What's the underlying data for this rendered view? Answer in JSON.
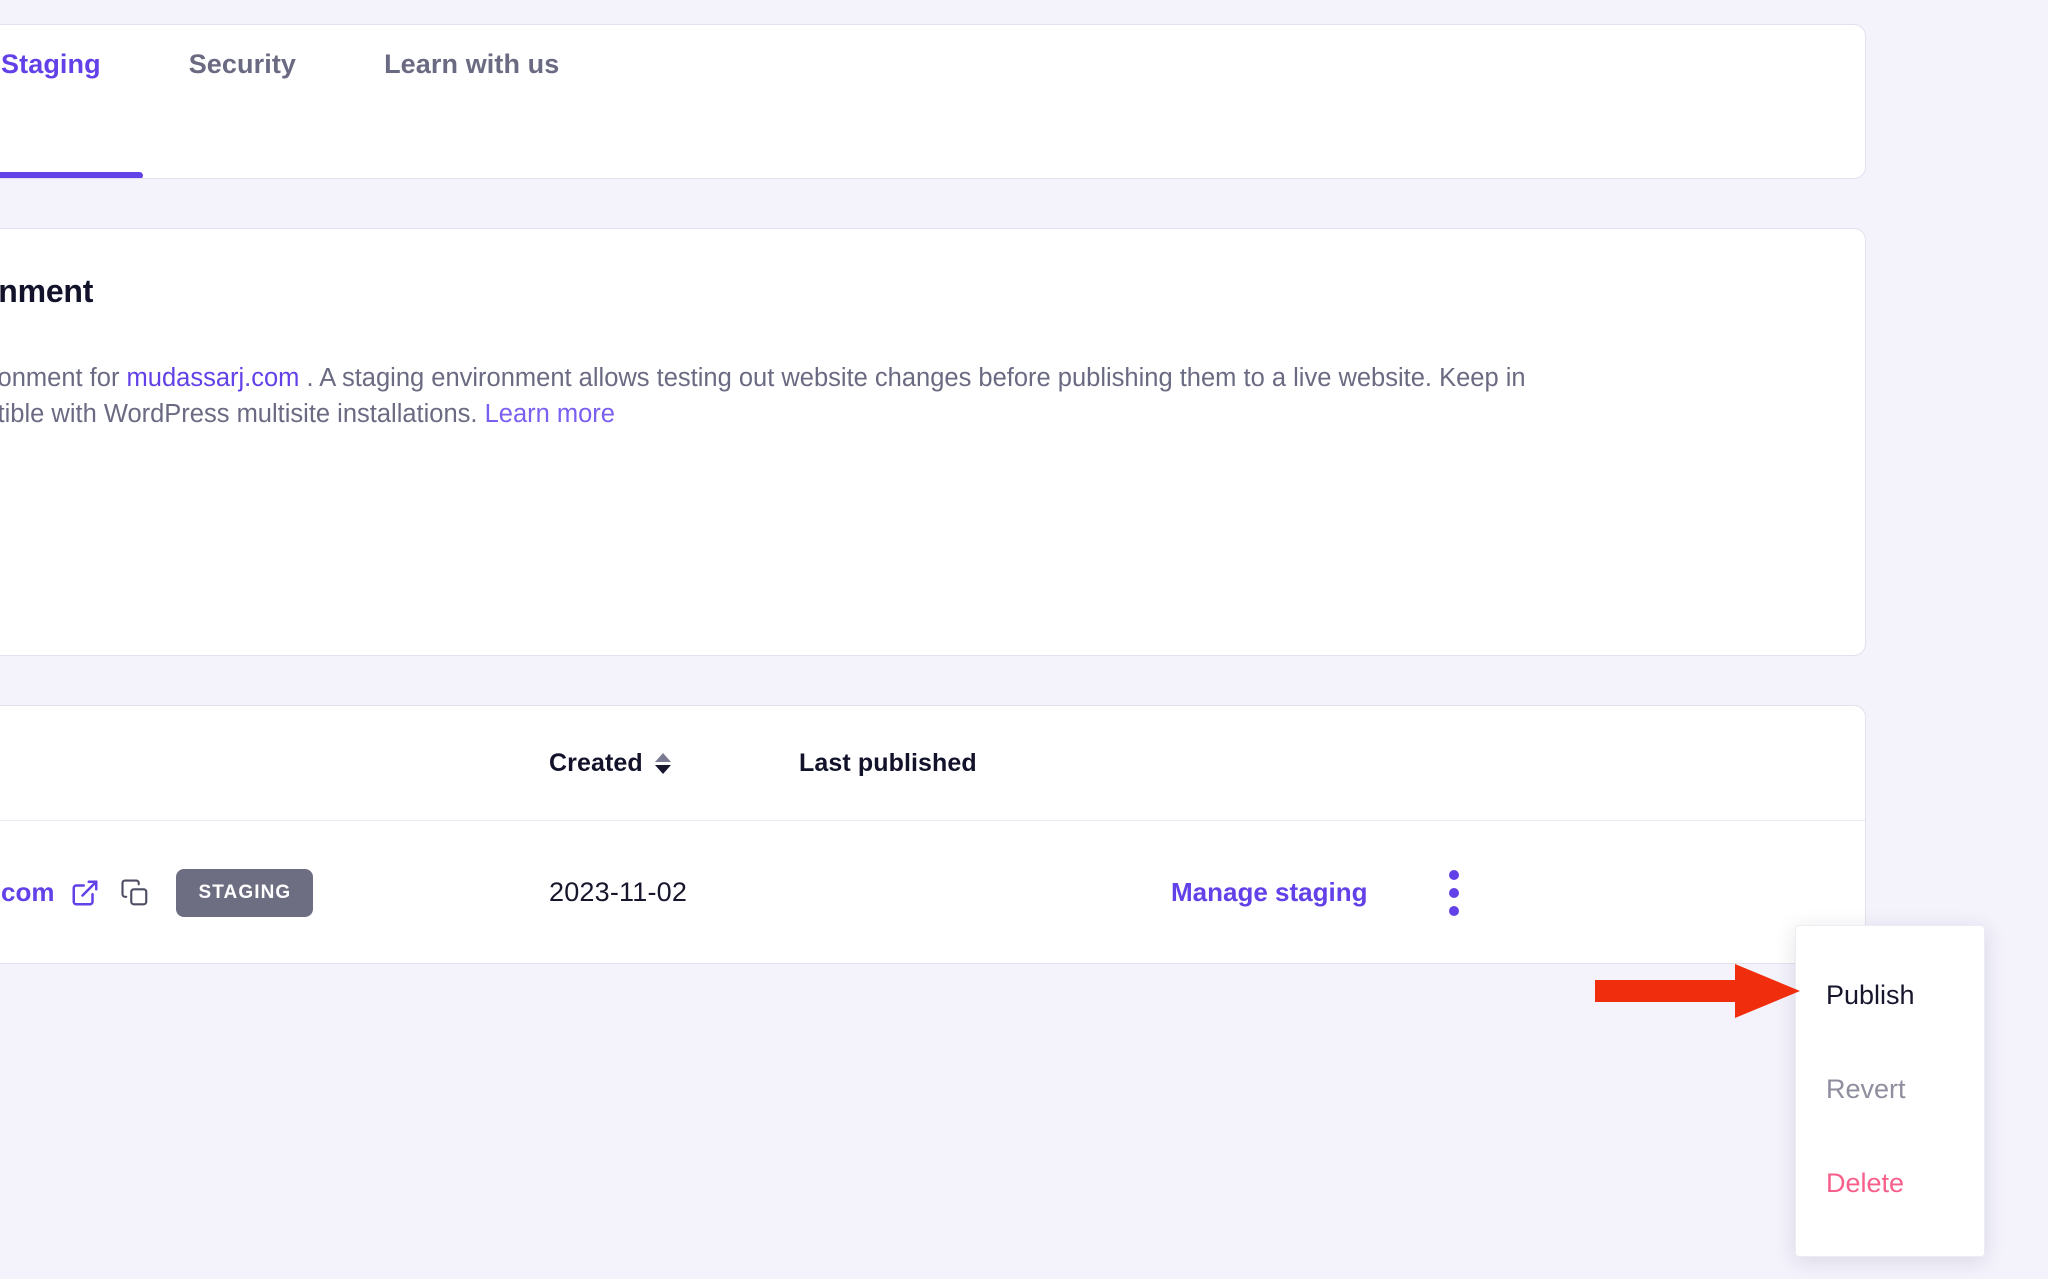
{
  "theme": {
    "accent": "#6341e8",
    "background": "#f4f3fc",
    "card": "#ffffff",
    "border": "#e2e1ec",
    "text_dark": "#12122b",
    "text_muted": "#6a6a83",
    "badge_bg": "#6e6e82",
    "danger": "#f75f8a",
    "annotation": "#f02d0c"
  },
  "tabs": [
    {
      "label": "Staging",
      "active": true
    },
    {
      "label": "Security",
      "active": false
    },
    {
      "label": "Learn with us",
      "active": false
    }
  ],
  "environment_card": {
    "title": "nvironment",
    "description_part1": "g environment for ",
    "site_link": "mudassarj.com",
    "description_part2": " . A staging environment allows testing out website changes before publishing them to a live website. Keep in  compatible with WordPress multisite installations. ",
    "learn_more": "Learn more",
    "button_label": ""
  },
  "table": {
    "headers": {
      "site": "",
      "created": "Created",
      "last_published": "Last published"
    },
    "sort_icon": "sort-updown-icon",
    "rows": [
      {
        "site_name": "com",
        "external_link_icon": "external-link-icon",
        "copy_icon": "copy-icon",
        "badge": "STAGING",
        "created": "2023-11-02",
        "last_published": "",
        "manage_label": "Manage staging",
        "kebab_icon": "kebab-menu-icon"
      }
    ]
  },
  "dropdown_menu": {
    "items": [
      {
        "label": "Publish",
        "state": "enabled"
      },
      {
        "label": "Revert",
        "state": "disabled"
      },
      {
        "label": "Delete",
        "state": "danger"
      }
    ]
  },
  "annotation": {
    "type": "arrow",
    "direction": "right",
    "color": "#f02d0c",
    "points_to": "Publish"
  }
}
